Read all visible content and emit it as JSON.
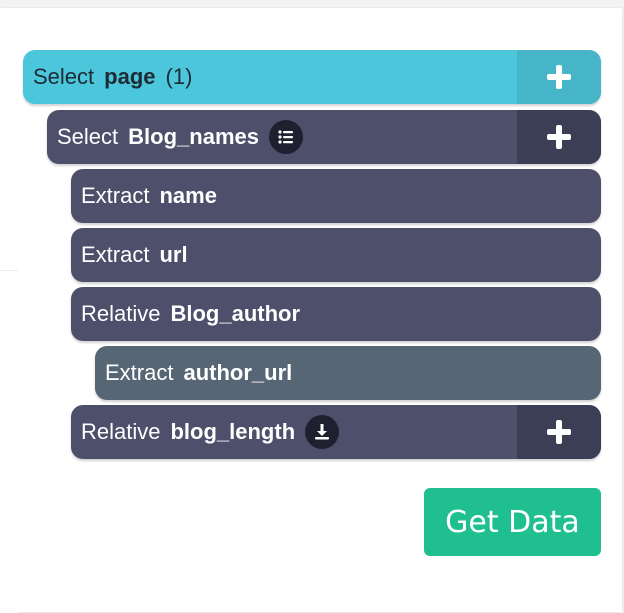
{
  "rows": [
    {
      "verb": "Select",
      "name": "page",
      "count": "(1)",
      "icon": "plus-icon"
    },
    {
      "verb": "Select",
      "name": "Blog_names",
      "icon": "list-icon",
      "action_icon": "plus-icon"
    },
    {
      "verb": "Extract",
      "name": "name"
    },
    {
      "verb": "Extract",
      "name": "url"
    },
    {
      "verb": "Relative",
      "name": "Blog_author"
    },
    {
      "verb": "Extract",
      "name": "author_url"
    },
    {
      "verb": "Relative",
      "name": "blog_length",
      "icon": "download-icon",
      "action_icon": "plus-icon"
    }
  ],
  "get_data_label": "Get Data",
  "colors": {
    "accent": "#4cc6da",
    "row_dark": "#4d4f6b",
    "row_slate": "#566675",
    "button_green": "#1fbf8f"
  }
}
